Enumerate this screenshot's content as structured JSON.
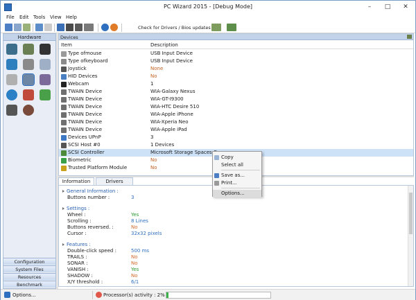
{
  "window": {
    "title": "PC Wizard 2015 - [Debug Mode]"
  },
  "menu": [
    "File",
    "Edit",
    "Tools",
    "View",
    "Help"
  ],
  "toolbar": {
    "check_label": "Check for Drivers / Bios updates"
  },
  "sidebar": {
    "header": "Hardware",
    "icons": [
      "motherboard-icon",
      "cpu-icon",
      "memory-icon",
      "video-icon",
      "connector-icon",
      "drive-icon",
      "printer-icon",
      "devices-icon",
      "audio-icon",
      "network-icon",
      "security-icon",
      "game-icon",
      "disk-icon",
      "gauge-icon"
    ],
    "bottom_buttons": [
      "Configuration",
      "System Files",
      "Resources",
      "Benchmark"
    ]
  },
  "devices": {
    "panel_title": "Devices",
    "columns": [
      "Item",
      "Description"
    ],
    "rows": [
      {
        "name": "Type ofmouse",
        "value": "USB Input Device",
        "color": "#1a1a1a",
        "icon_color": "#9a9a9a"
      },
      {
        "name": "Type ofkeyboard",
        "value": "USB Input Device",
        "color": "#1a1a1a",
        "icon_color": "#8a8a8a"
      },
      {
        "name": "Joystick",
        "value": "None",
        "color": "#c06020",
        "icon_color": "#555555"
      },
      {
        "name": "HID Devices",
        "value": "No",
        "color": "#c06020",
        "icon_color": "#4a7fc1"
      },
      {
        "name": "Webcam",
        "value": "1",
        "color": "#1a1a1a",
        "icon_color": "#222222"
      },
      {
        "name": "TWAIN Device",
        "value": "WIA-Galaxy Nexus",
        "color": "#1a1a1a",
        "icon_color": "#6f6f6f"
      },
      {
        "name": "TWAIN Device",
        "value": "WIA-GT-I9300",
        "color": "#1a1a1a",
        "icon_color": "#6f6f6f"
      },
      {
        "name": "TWAIN Device",
        "value": "WIA-HTC Desire 510",
        "color": "#1a1a1a",
        "icon_color": "#6f6f6f"
      },
      {
        "name": "TWAIN Device",
        "value": "WIA-Apple iPhone",
        "color": "#1a1a1a",
        "icon_color": "#6f6f6f"
      },
      {
        "name": "TWAIN Device",
        "value": "WIA-Xperia Neo",
        "color": "#1a1a1a",
        "icon_color": "#6f6f6f"
      },
      {
        "name": "TWAIN Device",
        "value": "WIA-Apple iPad",
        "color": "#1a1a1a",
        "icon_color": "#6f6f6f"
      },
      {
        "name": "Devices UPnP",
        "value": "3",
        "color": "#1a1a1a",
        "icon_color": "#3c78c3"
      },
      {
        "name": "SCSI Host #0",
        "value": "1 Devices",
        "color": "#1a1a1a",
        "icon_color": "#555555"
      },
      {
        "name": "SCSI Controller",
        "value": "Microsoft Storage Spaces Co",
        "color": "#1a1a1a",
        "icon_color": "#4d8a3a"
      },
      {
        "name": "Biometric",
        "value": "No",
        "color": "#c06020",
        "icon_color": "#3aa047"
      },
      {
        "name": "Trusted Platform Module",
        "value": "No",
        "color": "#c06020",
        "icon_color": "#c9a21c"
      }
    ]
  },
  "tabs": [
    "Information",
    "Drivers"
  ],
  "info": {
    "sections": [
      {
        "title": "General Information :",
        "items": [
          {
            "key": "Buttons number :",
            "value": "3",
            "color": "#2f6fbf"
          }
        ]
      },
      {
        "title": "Settings :",
        "items": [
          {
            "key": "Wheel :",
            "value": "Yes",
            "color": "#2e9a34"
          },
          {
            "key": "Scrolling :",
            "value": "8 Lines",
            "color": "#2f6fbf"
          },
          {
            "key": "Buttons reversed. :",
            "value": "No",
            "color": "#d2692a"
          },
          {
            "key": "Cursor :",
            "value": "32x32 pixels",
            "color": "#2f6fbf"
          }
        ]
      },
      {
        "title": "Features :",
        "items": [
          {
            "key": "Double-click speed :",
            "value": "500 ms",
            "color": "#2f6fbf"
          },
          {
            "key": "TRAILS :",
            "value": "No",
            "color": "#d2692a"
          },
          {
            "key": "SONAR :",
            "value": "No",
            "color": "#d2692a"
          },
          {
            "key": "VANISH :",
            "value": "Yes",
            "color": "#2e9a34"
          },
          {
            "key": "SHADOW :",
            "value": "No",
            "color": "#d2692a"
          },
          {
            "key": "X/Y threshold :",
            "value": "6/1",
            "color": "#2f6fbf"
          }
        ]
      }
    ]
  },
  "context_menu": [
    "Copy",
    "Select all",
    "Save as...",
    "Print...",
    "Options..."
  ],
  "status": {
    "left": "Options...",
    "activity": "Processor(s) activity : 2%",
    "activity_percent": 2
  }
}
